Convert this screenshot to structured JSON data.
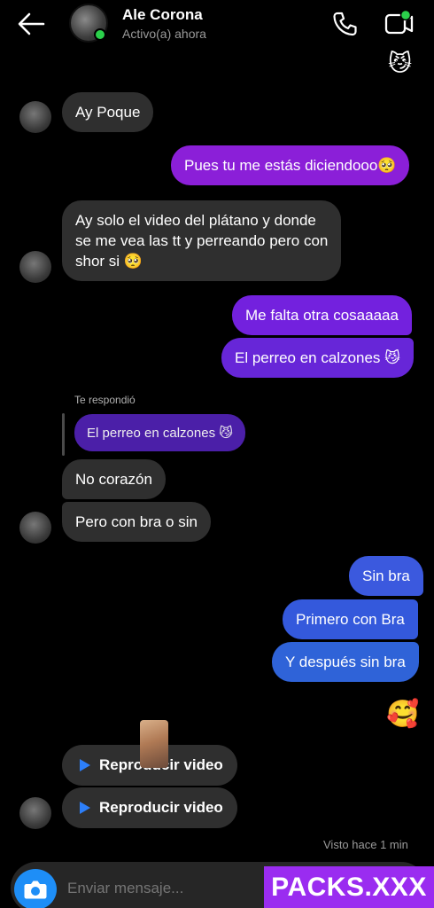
{
  "header": {
    "contact_name": "Ale Corona",
    "status": "Activo(a) ahora",
    "icons": [
      "back-arrow-icon",
      "phone-icon",
      "video-camera-icon"
    ]
  },
  "top_emoji": "😼",
  "messages": [
    {
      "id": 1,
      "from": "them",
      "text": "Ay Poque"
    },
    {
      "id": 2,
      "from": "me",
      "text": "Pues tu me estás diciendooo🥺"
    },
    {
      "id": 3,
      "from": "them",
      "lines": [
        "Ay solo el video del plátano y donde",
        "se me vea las tt y perreando pero con",
        "shor si 🥺"
      ]
    },
    {
      "id": 4,
      "from": "me",
      "text": "Me falta otra cosaaaaa"
    },
    {
      "id": 5,
      "from": "me",
      "text": "El perreo en calzones 😼"
    },
    {
      "id": 6,
      "from": "them",
      "reply_label": "Te respondió",
      "quoted": "El perreo en calzones 😼"
    },
    {
      "id": 7,
      "from": "them",
      "text": "No corazón"
    },
    {
      "id": 8,
      "from": "them",
      "text": "Pero con bra o sin"
    },
    {
      "id": 9,
      "from": "me",
      "text": "Sin bra"
    },
    {
      "id": 10,
      "from": "me",
      "text": "Primero con Bra"
    },
    {
      "id": 11,
      "from": "me",
      "text": "Y después sin bra"
    },
    {
      "id": 12,
      "from": "me",
      "emoji": "🥰"
    },
    {
      "id": 13,
      "from": "them",
      "video_label": "Reproducir video"
    },
    {
      "id": 14,
      "from": "them",
      "video_label": "Reproducir video"
    }
  ],
  "seen_text": "Visto hace 1 min",
  "composer": {
    "placeholder": "Enviar mensaje...",
    "camera_icon": "camera-icon"
  },
  "watermark": "PACKS.XXX",
  "colors": {
    "background": "#000000",
    "incoming_bubble": "#2f2f2f",
    "outgoing_purple": "#8b1fd8",
    "outgoing_blue": "#2f63d8",
    "online": "#2bd04b",
    "camera_button": "#1e8ef7",
    "watermark_bg": "#9a2cf0"
  }
}
